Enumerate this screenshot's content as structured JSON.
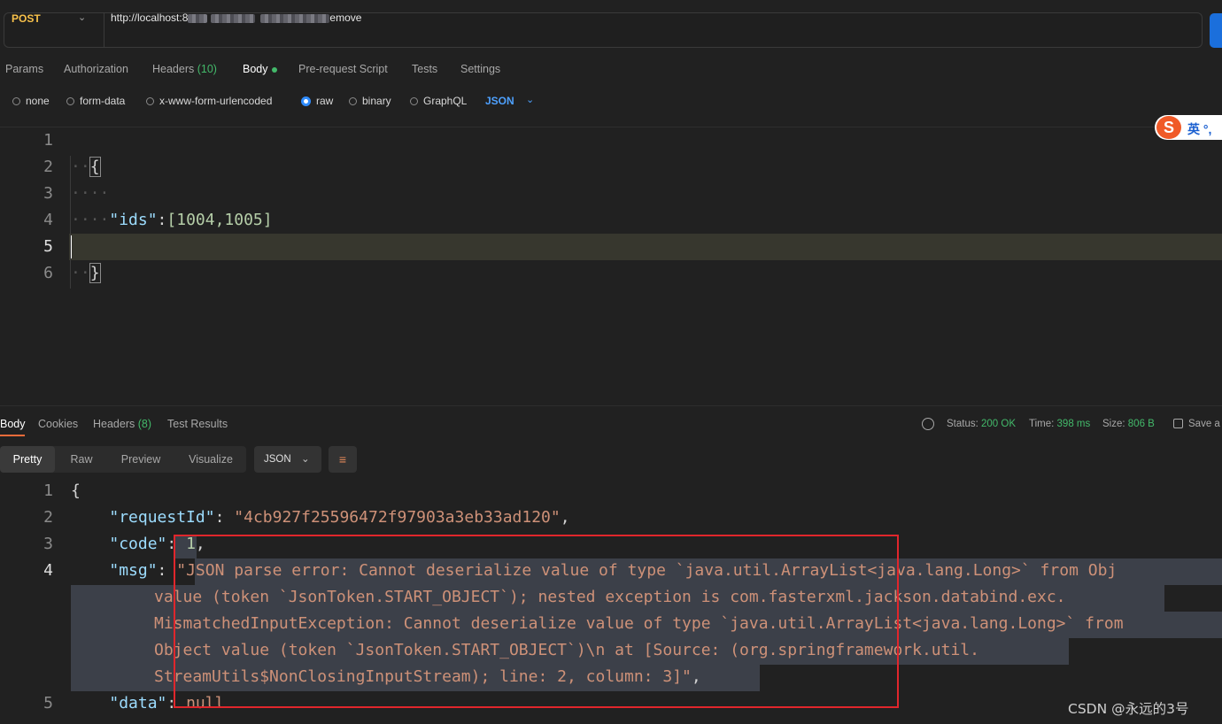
{
  "request": {
    "method": "POST",
    "url_prefix": "http://localhost:8",
    "url_suffix": "emove"
  },
  "request_tabs": [
    {
      "label": "Params"
    },
    {
      "label": "Authorization"
    },
    {
      "label": "Headers",
      "count": "(10)"
    },
    {
      "label": "Body"
    },
    {
      "label": "Pre-request Script"
    },
    {
      "label": "Tests"
    },
    {
      "label": "Settings"
    }
  ],
  "body_types": [
    "none",
    "form-data",
    "x-www-form-urlencoded",
    "raw",
    "binary",
    "GraphQL"
  ],
  "body_format": "JSON",
  "ime": {
    "logo": "S",
    "text": "英 °,"
  },
  "editor": {
    "line_numbers": [
      "1",
      "2",
      "3",
      "4",
      "5",
      "6"
    ],
    "open_brace": "{",
    "key": "\"ids\"",
    "colon": ":",
    "value": "[1004,1005]",
    "close_brace": "}"
  },
  "response_tabs": [
    {
      "label": "Body"
    },
    {
      "label": "Cookies"
    },
    {
      "label": "Headers",
      "count": "(8)"
    },
    {
      "label": "Test Results"
    }
  ],
  "response_status": {
    "status_label": "Status:",
    "status_value": "200 OK",
    "time_label": "Time:",
    "time_value": "398 ms",
    "size_label": "Size:",
    "size_value": "806 B",
    "save_label": "Save a"
  },
  "view_modes": [
    "Pretty",
    "Raw",
    "Preview",
    "Visualize"
  ],
  "response_format": "JSON",
  "response": {
    "line_numbers": [
      "1",
      "2",
      "3",
      "4",
      "5"
    ],
    "open": "{",
    "requestId_key": "\"requestId\"",
    "requestId_value": "\"4cb927f25596472f97903a3eb33ad120\"",
    "code_key": "\"code\"",
    "code_value": "1",
    "msg_key": "\"msg\"",
    "msg_lines": [
      "\"JSON parse error: Cannot deserialize value of type `java.util.ArrayList<java.lang.Long>` from Obj",
      "value (token `JsonToken.START_OBJECT`); nested exception is com.fasterxml.jackson.databind.exc.",
      "MismatchedInputException: Cannot deserialize value of type `java.util.ArrayList<java.lang.Long>` from",
      "Object value (token `JsonToken.START_OBJECT`)\\n at [Source: (org.springframework.util.",
      "StreamUtils$NonClosingInputStream); line: 2, column: 3]\""
    ],
    "data_key": "\"data\"",
    "data_value": "null"
  },
  "watermark": "CSDN @永远的3号"
}
